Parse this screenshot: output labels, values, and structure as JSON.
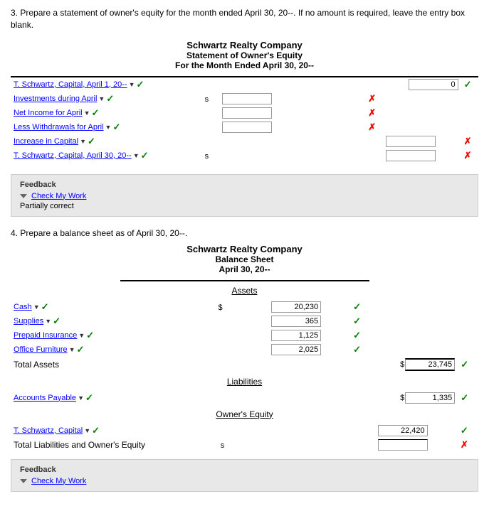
{
  "page": {
    "instruction3": "3. Prepare a statement of owner's equity for the month ended April 30, 20--. If no amount is required, leave the entry box blank.",
    "instruction4": "4. Prepare a balance sheet as of April 30, 20--.",
    "equity_statement": {
      "company_name": "Schwartz Realty Company",
      "title": "Statement of Owner's Equity",
      "date": "For the Month Ended April 30, 20--",
      "rows": [
        {
          "label": "T. Schwartz, Capital, April 1, 20--",
          "dollar_prefix": "",
          "input_value": "0",
          "check": "green",
          "col": "right"
        },
        {
          "label": "Investments during April",
          "dollar_prefix": "s",
          "input_value": "",
          "check": "red",
          "col": "left"
        },
        {
          "label": "Net Income for April",
          "dollar_prefix": "",
          "input_value": "",
          "check": "red",
          "col": "left"
        },
        {
          "label": "Less Withdrawals for April",
          "dollar_prefix": "",
          "input_value": "",
          "check": "red",
          "col": "left"
        },
        {
          "label": "Increase in Capital",
          "dollar_prefix": "",
          "input_value": "",
          "check": "red",
          "col": "right"
        },
        {
          "label": "T. Schwartz, Capital, April 30, 20--",
          "dollar_prefix": "s",
          "input_value": "",
          "check": "red",
          "col": "right"
        }
      ]
    },
    "feedback3": {
      "title": "Feedback",
      "check_my_work": "Check My Work",
      "status": "Partially correct"
    },
    "balance_sheet": {
      "company_name": "Schwartz Realty Company",
      "title": "Balance Sheet",
      "date": "April 30, 20--",
      "assets_label": "Assets",
      "assets": [
        {
          "label": "Cash",
          "value": "20,230",
          "check": "green"
        },
        {
          "label": "Supplies",
          "value": "365",
          "check": "green"
        },
        {
          "label": "Prepaid Insurance",
          "value": "1,125",
          "check": "green"
        },
        {
          "label": "Office Furniture",
          "value": "2,025",
          "check": "green"
        }
      ],
      "total_assets_label": "Total Assets",
      "total_assets_dollar": "s",
      "total_assets_value": "23,745",
      "total_assets_check": "green",
      "liabilities_label": "Liabilities",
      "liabilities": [
        {
          "label": "Accounts Payable",
          "dollar": "s",
          "value": "1,335",
          "check": "green"
        }
      ],
      "owners_equity_label": "Owner's Equity",
      "owners_equity": [
        {
          "label": "T. Schwartz, Capital",
          "value": "22,420",
          "check": "green"
        }
      ],
      "total_liab_equity_label": "Total Liabilities and Owner's Equity",
      "total_liab_dollar": "s",
      "total_liab_value": "",
      "total_liab_check": "red"
    },
    "feedback4": {
      "title": "Feedback",
      "check_my_work": "Check My Work"
    }
  }
}
